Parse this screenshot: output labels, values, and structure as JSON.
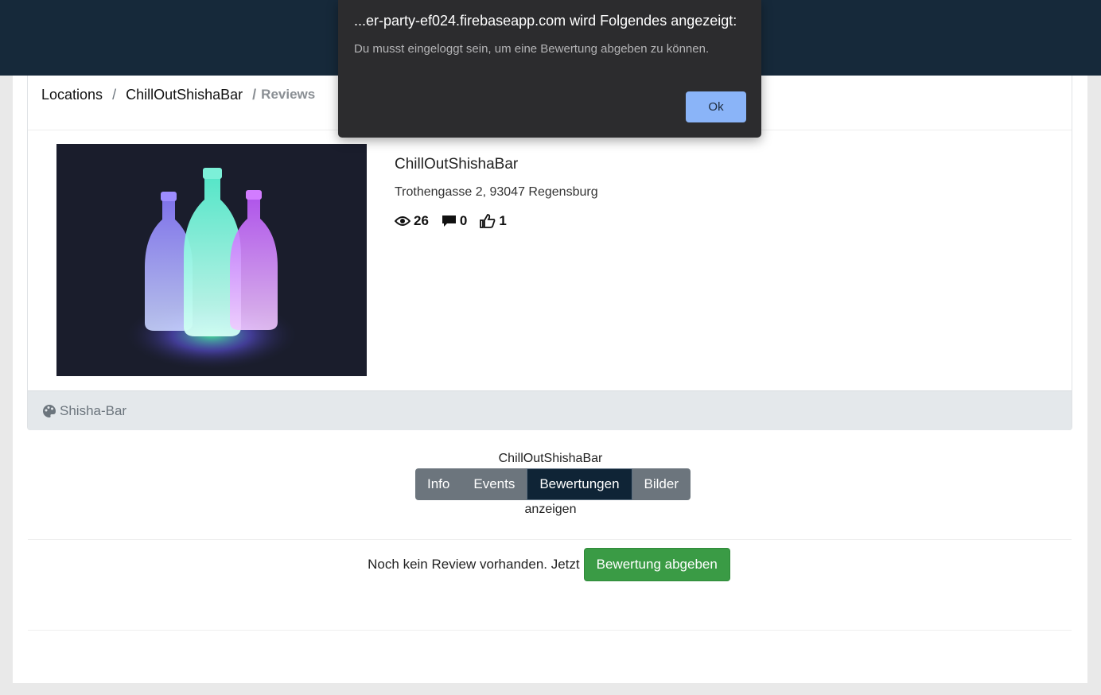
{
  "dialog": {
    "title": "...er-party-ef024.firebaseapp.com wird Folgendes angezeigt:",
    "message": "Du musst eingeloggt sein, um eine Bewertung abgeben zu können.",
    "ok_label": "Ok"
  },
  "breadcrumb": {
    "items": [
      "Locations",
      "ChillOutShishaBar"
    ],
    "separator": "/",
    "active": "Reviews"
  },
  "location": {
    "name": "ChillOutShishaBar",
    "address": "Trothengasse 2, 93047 Regensburg",
    "views": "26",
    "comments": "0",
    "likes": "1",
    "category": "Shisha-Bar"
  },
  "tabs": {
    "caption_top": "ChillOutShishaBar",
    "caption_bottom": "anzeigen",
    "items": [
      "Info",
      "Events",
      "Bewertungen",
      "Bilder"
    ],
    "active": "Bewertungen"
  },
  "reviews": {
    "empty_text": "Noch kein Review vorhanden. Jetzt",
    "submit_label": "Bewertung abgeben"
  },
  "colors": {
    "topbar": "#16293a",
    "primary_dialog_button": "#8ab4f8",
    "success": "#3a9b45",
    "tab_active": "#0f2436"
  }
}
